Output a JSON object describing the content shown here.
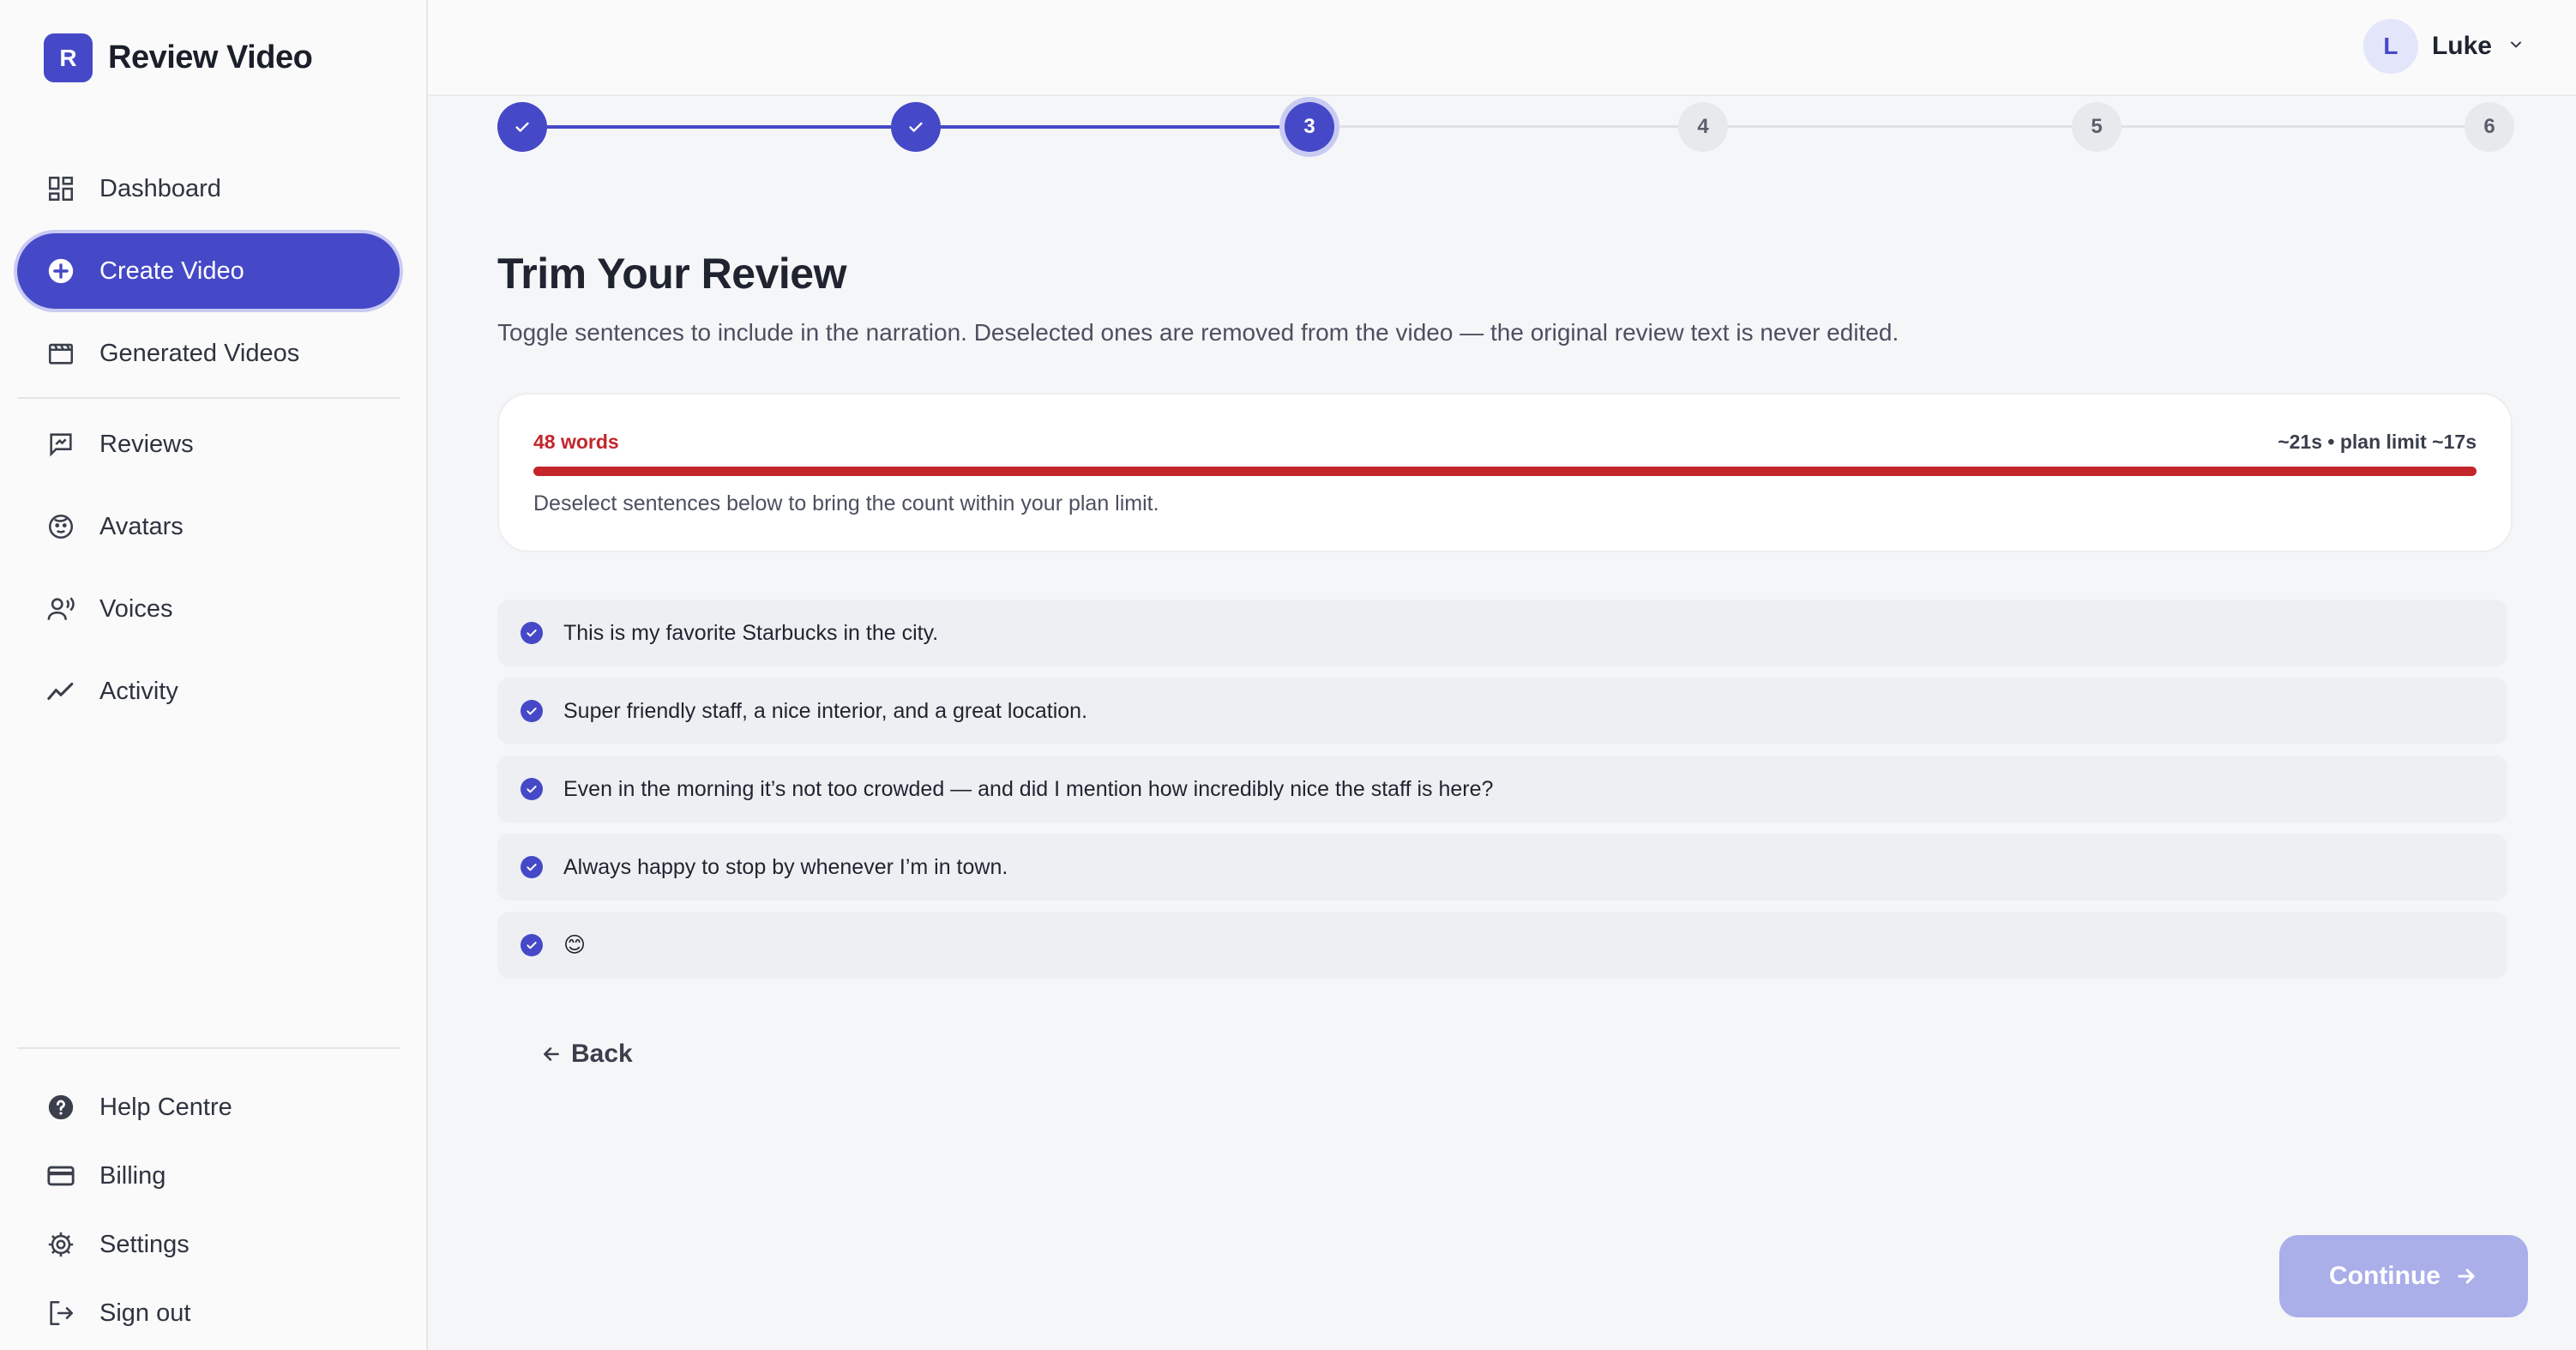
{
  "brand": {
    "initial": "R",
    "name": "Review Video"
  },
  "nav": {
    "primary": [
      {
        "label": "Dashboard",
        "icon": "dashboard-icon"
      },
      {
        "label": "Create Video",
        "icon": "plus-circle-icon",
        "active": true
      },
      {
        "label": "Generated Videos",
        "icon": "film-icon"
      }
    ],
    "secondary": [
      {
        "label": "Reviews",
        "icon": "review-icon"
      },
      {
        "label": "Avatars",
        "icon": "face-icon"
      },
      {
        "label": "Voices",
        "icon": "voice-icon"
      },
      {
        "label": "Activity",
        "icon": "activity-icon"
      }
    ],
    "footer": [
      {
        "label": "Help Centre",
        "icon": "help-icon"
      },
      {
        "label": "Billing",
        "icon": "credit-card-icon"
      },
      {
        "label": "Settings",
        "icon": "gear-icon"
      },
      {
        "label": "Sign out",
        "icon": "sign-out-icon"
      }
    ]
  },
  "user": {
    "initial": "L",
    "name": "Luke"
  },
  "stepper": {
    "steps": [
      {
        "label": "",
        "state": "done"
      },
      {
        "label": "",
        "state": "done"
      },
      {
        "label": "3",
        "state": "current"
      },
      {
        "label": "4",
        "state": "todo"
      },
      {
        "label": "5",
        "state": "todo"
      },
      {
        "label": "6",
        "state": "todo"
      }
    ]
  },
  "page": {
    "title": "Trim Your Review",
    "subtitle": "Toggle sentences to include in the narration. Deselected ones are removed from the video — the original review text is never edited."
  },
  "usage": {
    "word_count": "48 words",
    "duration": "~21s • plan limit ~17s",
    "progress": 1.0,
    "hint": "Deselect sentences below to bring the count within your plan limit.",
    "warning_color": "#c3252b"
  },
  "sentences": [
    {
      "text": "This is my favorite Starbucks in the city.",
      "selected": true
    },
    {
      "text": "Super friendly staff, a nice interior, and a great location.",
      "selected": true
    },
    {
      "text": "Even in the morning it’s not too crowded — and did I mention how incredibly nice the staff is here?",
      "selected": true
    },
    {
      "text": "Always happy to stop by whenever I’m in town.",
      "selected": true
    },
    {
      "text": "😊",
      "selected": true
    }
  ],
  "actions": {
    "back": "Back",
    "continue": "Continue"
  },
  "colors": {
    "accent": "#4549c7",
    "accent_light": "#c9cbf3",
    "continue_disabled": "#aaaee9"
  }
}
